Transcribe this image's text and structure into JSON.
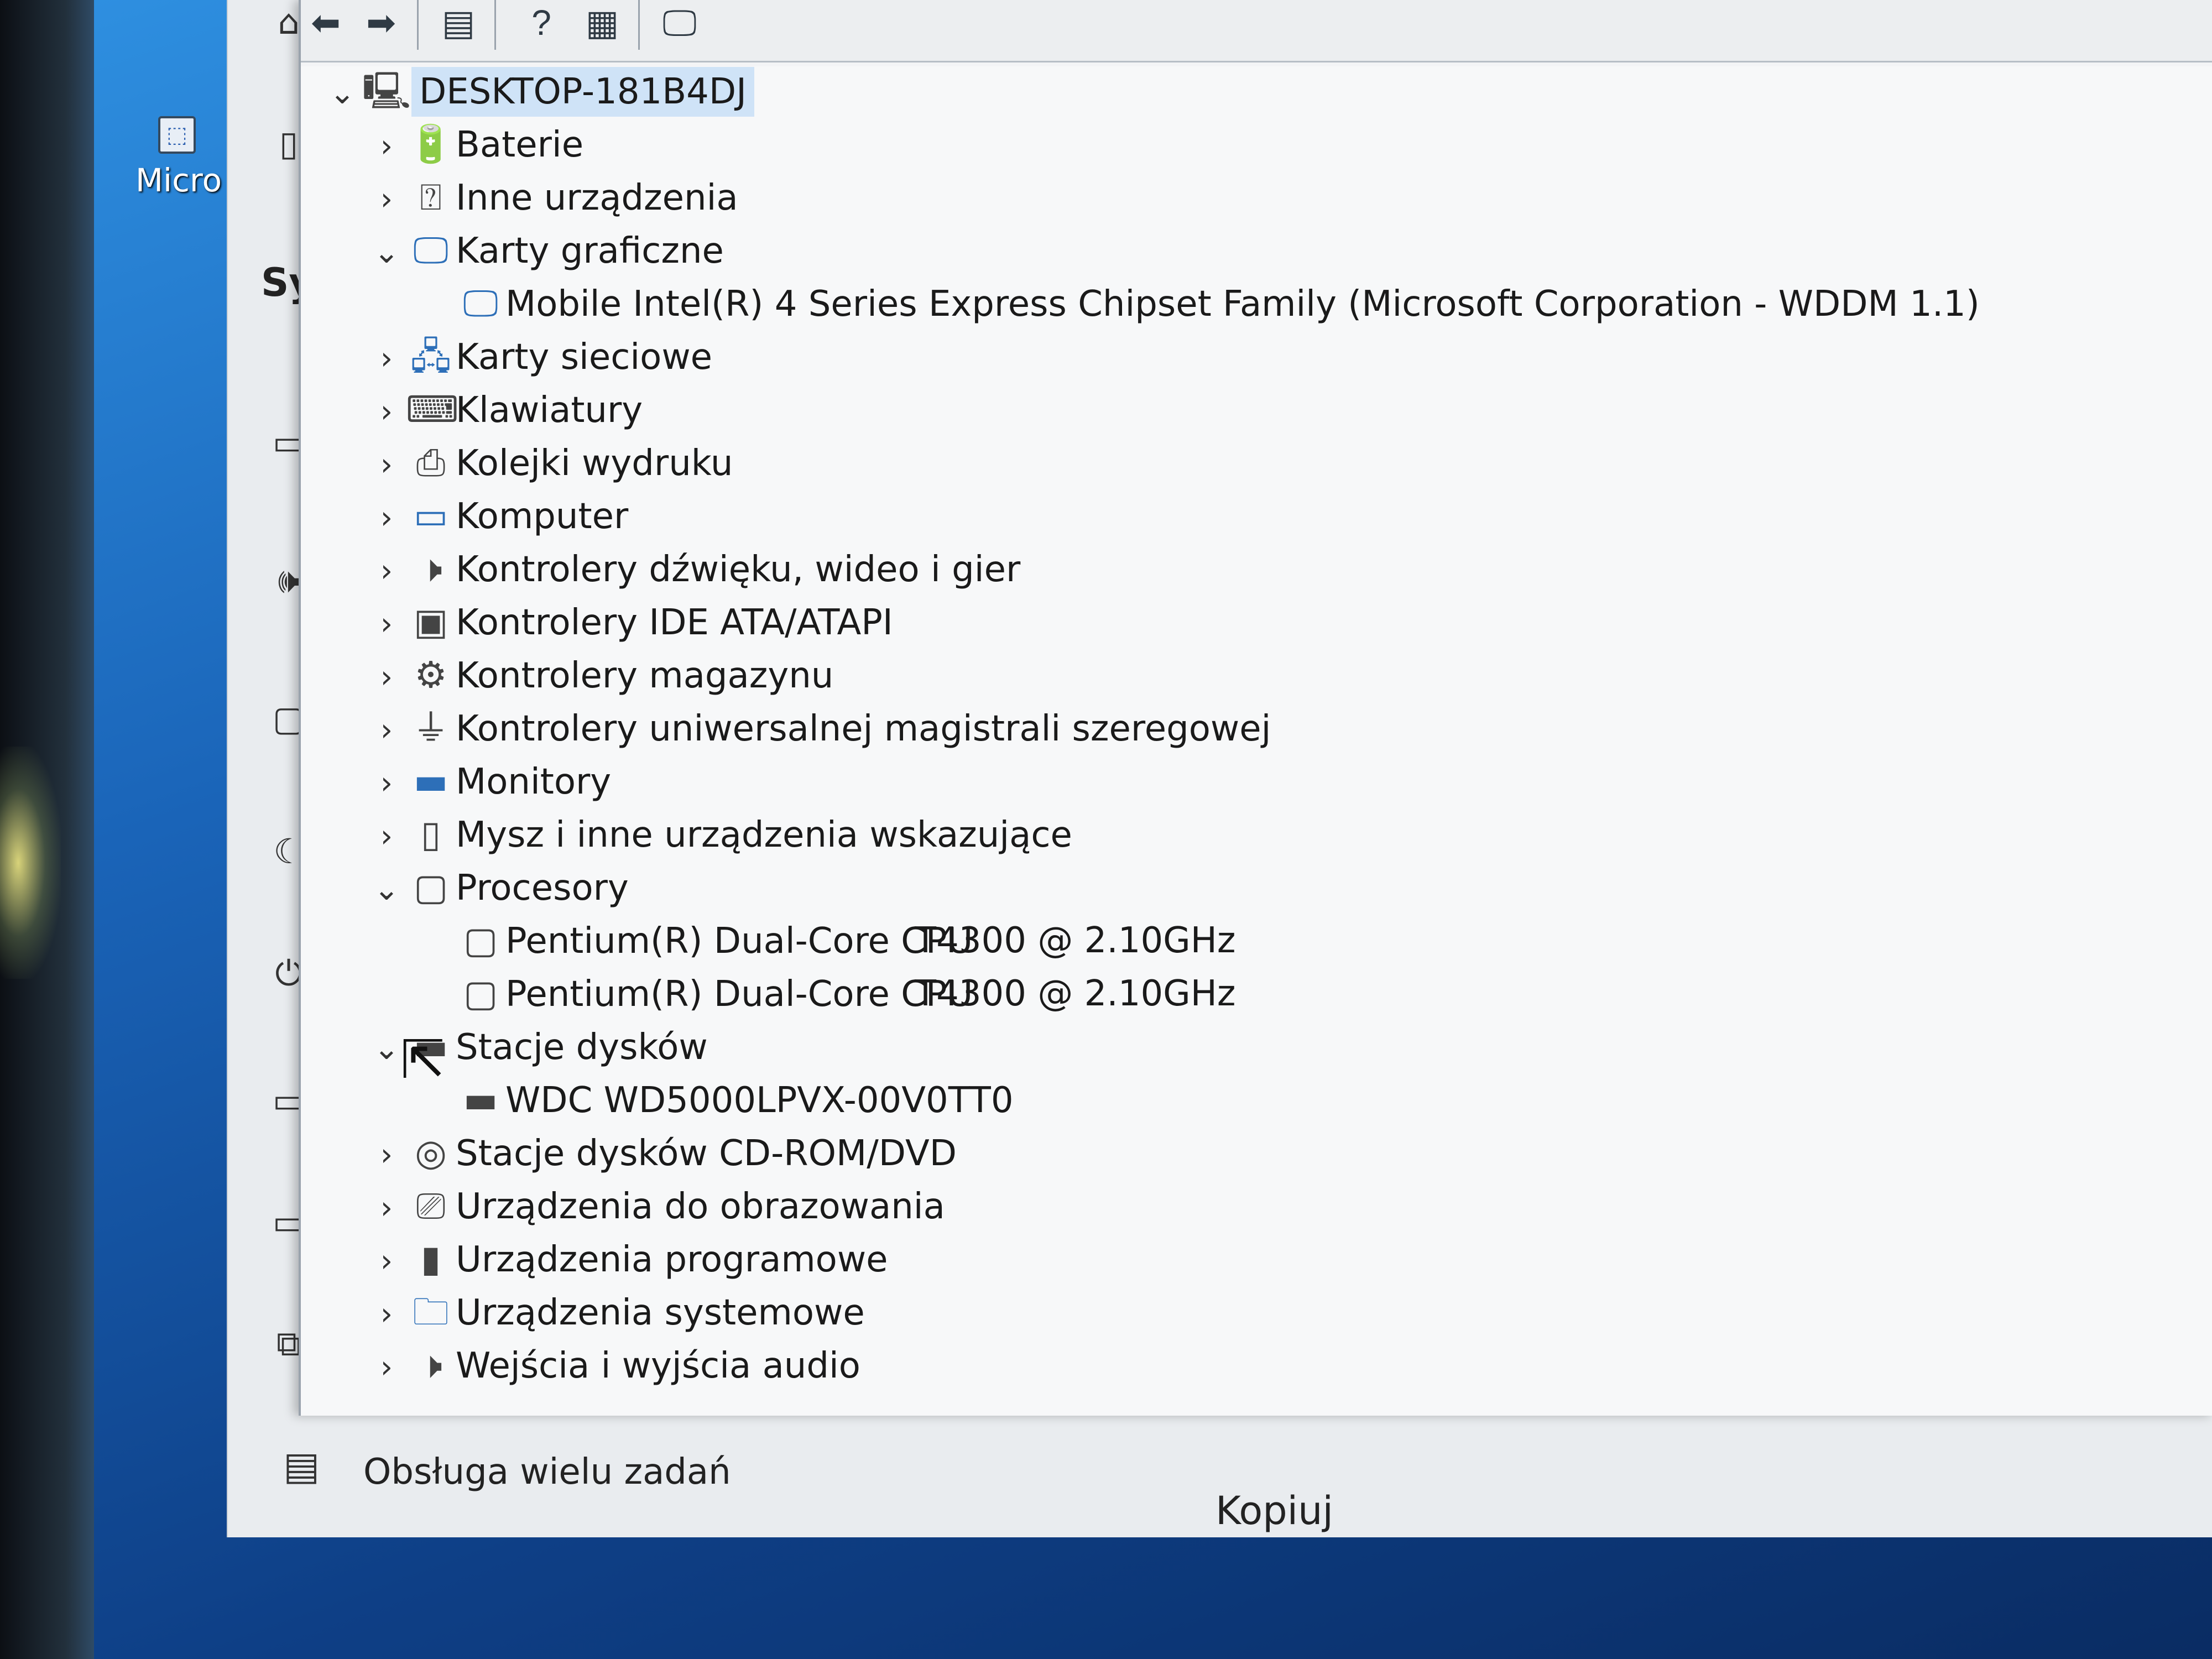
{
  "desktop": {
    "icon_label": "Micro"
  },
  "settings": {
    "partial_heading": "Sy",
    "footer_text": "Obsługa wielu zadań",
    "copy_button": "Kopiuj"
  },
  "device_manager": {
    "root": "DESKTOP-181B4DJ",
    "tree": [
      {
        "label": "Baterie",
        "expanded": false,
        "icon": "battery-icon"
      },
      {
        "label": "Inne urządzenia",
        "expanded": false,
        "icon": "unknown-device-icon"
      },
      {
        "label": "Karty graficzne",
        "expanded": true,
        "icon": "display-adapter-icon",
        "children": [
          {
            "label": "Mobile Intel(R) 4 Series Express Chipset Family (Microsoft Corporation - WDDM 1.1)"
          }
        ]
      },
      {
        "label": "Karty sieciowe",
        "expanded": false,
        "icon": "network-adapter-icon"
      },
      {
        "label": "Klawiatury",
        "expanded": false,
        "icon": "keyboard-icon"
      },
      {
        "label": "Kolejki wydruku",
        "expanded": false,
        "icon": "printer-icon"
      },
      {
        "label": "Komputer",
        "expanded": false,
        "icon": "computer-icon"
      },
      {
        "label": "Kontrolery dźwięku, wideo i gier",
        "expanded": false,
        "icon": "speaker-icon"
      },
      {
        "label": "Kontrolery IDE ATA/ATAPI",
        "expanded": false,
        "icon": "ide-controller-icon"
      },
      {
        "label": "Kontrolery magazynu",
        "expanded": false,
        "icon": "storage-controller-icon"
      },
      {
        "label": "Kontrolery uniwersalnej magistrali szeregowej",
        "expanded": false,
        "icon": "usb-icon"
      },
      {
        "label": "Monitory",
        "expanded": false,
        "icon": "monitor-icon"
      },
      {
        "label": "Mysz i inne urządzenia wskazujące",
        "expanded": false,
        "icon": "mouse-icon"
      },
      {
        "label": "Procesory",
        "expanded": true,
        "icon": "processor-icon",
        "children": [
          {
            "label": "Pentium(R) Dual-Core CPU",
            "model": "T4300  @ 2.10GHz"
          },
          {
            "label": "Pentium(R) Dual-Core CPU",
            "model": "T4300  @ 2.10GHz"
          }
        ]
      },
      {
        "label": "Stacje dysków",
        "expanded": true,
        "icon": "disk-drive-icon",
        "children": [
          {
            "label": "WDC WD5000LPVX-00V0TT0"
          }
        ]
      },
      {
        "label": "Stacje dysków CD-ROM/DVD",
        "expanded": false,
        "icon": "cdrom-icon"
      },
      {
        "label": "Urządzenia do obrazowania",
        "expanded": false,
        "icon": "camera-icon"
      },
      {
        "label": "Urządzenia programowe",
        "expanded": false,
        "icon": "software-device-icon"
      },
      {
        "label": "Urządzenia systemowe",
        "expanded": false,
        "icon": "system-folder-icon"
      },
      {
        "label": "Wejścia i wyjścia audio",
        "expanded": false,
        "icon": "audio-io-icon"
      }
    ]
  }
}
